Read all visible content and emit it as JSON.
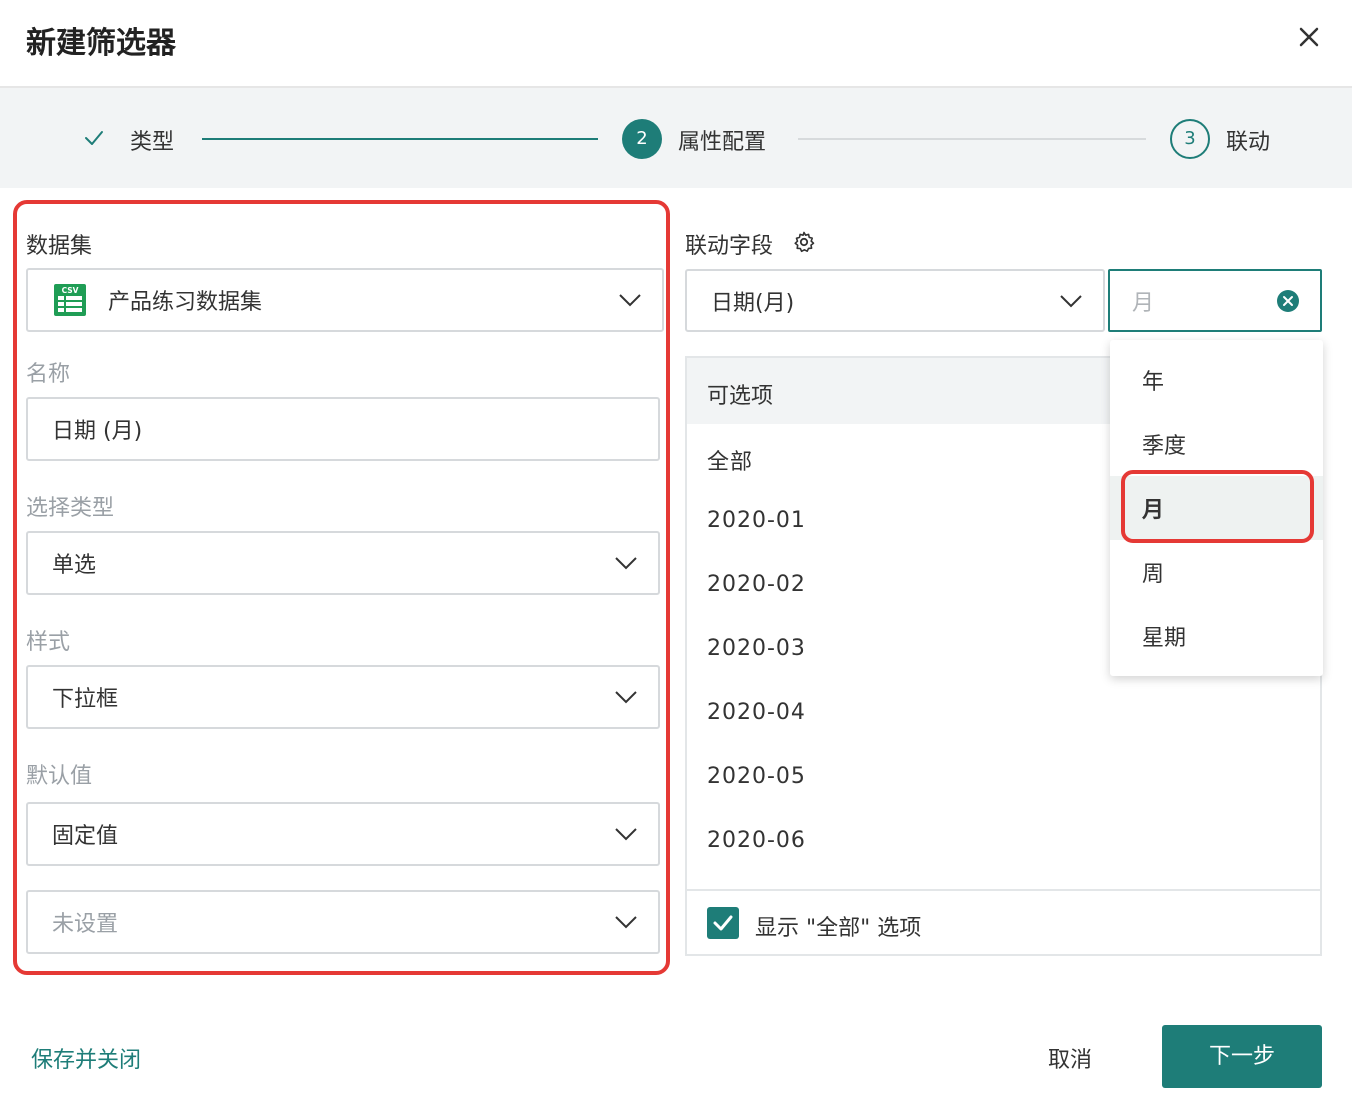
{
  "dialog": {
    "title": "新建筛选器"
  },
  "steps": [
    {
      "label": "类型",
      "state": "done"
    },
    {
      "number": "2",
      "label": "属性配置",
      "state": "active"
    },
    {
      "number": "3",
      "label": "联动",
      "state": "todo"
    }
  ],
  "form": {
    "dataset": {
      "label": "数据集",
      "value": "产品练习数据集",
      "icon": "csv-file-icon",
      "icon_text": "CSV"
    },
    "name": {
      "label": "名称",
      "value": "日期 (月)"
    },
    "select_type": {
      "label": "选择类型",
      "value": "单选"
    },
    "style": {
      "label": "样式",
      "value": "下拉框"
    },
    "default_value": {
      "label": "默认值",
      "value": "固定值",
      "sub_value": "未设置"
    }
  },
  "linkage": {
    "label": "联动字段",
    "field_value": "日期(月)",
    "granularity_placeholder": "月",
    "granularity_options": [
      "年",
      "季度",
      "月",
      "周",
      "星期"
    ],
    "granularity_selected": "月"
  },
  "options_panel": {
    "header": "可选项",
    "items": [
      "全部",
      "2020-01",
      "2020-02",
      "2020-03",
      "2020-04",
      "2020-05",
      "2020-06"
    ],
    "show_all_label": "显示 \"全部\" 选项",
    "show_all_checked": true
  },
  "footer": {
    "save_close": "保存并关闭",
    "cancel": "取消",
    "next": "下一步"
  },
  "colors": {
    "accent": "#1e7d78",
    "highlight": "#e53935"
  }
}
